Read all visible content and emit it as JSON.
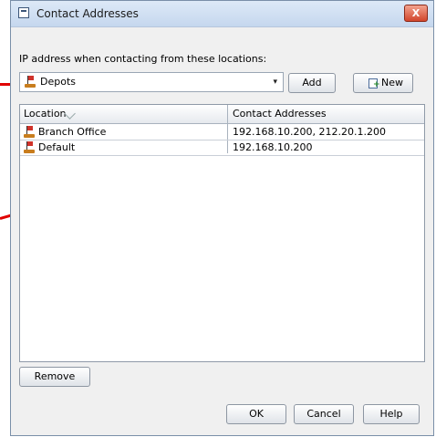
{
  "window": {
    "title": "Contact Addresses",
    "close_label": "X"
  },
  "ip_label": "IP address when contacting from these locations:",
  "combo": {
    "selected": "Depots",
    "arrow": "▾"
  },
  "buttons": {
    "add": "Add",
    "new": "New",
    "remove": "Remove",
    "ok": "OK",
    "cancel": "Cancel",
    "help": "Help"
  },
  "table": {
    "headers": [
      "Location",
      "Contact Addresses"
    ],
    "rows": [
      {
        "location": "Branch Office",
        "addresses": "192.168.10.200, 212.20.1.200"
      },
      {
        "location": "Default",
        "addresses": "192.168.10.200"
      }
    ]
  },
  "colors": {
    "annotation": "#e00000"
  }
}
